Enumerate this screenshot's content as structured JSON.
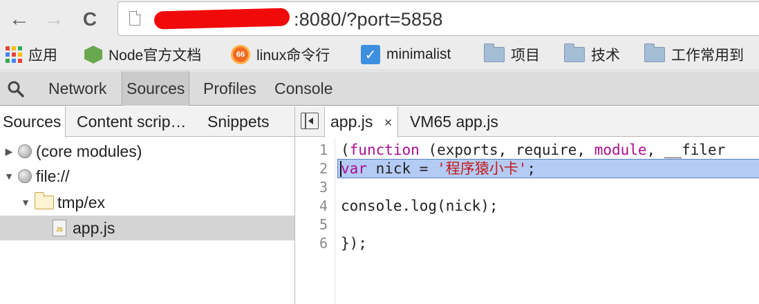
{
  "browser": {
    "back_icon": "←",
    "forward_icon": "→",
    "reload_icon": "C",
    "url_visible": ":8080/?port=5858"
  },
  "bookmarks": [
    {
      "label": "应用",
      "icon": "apps-grid-icon"
    },
    {
      "label": "Node官方文档",
      "icon": "node-icon"
    },
    {
      "label": "linux命令行",
      "icon": "site-66-icon"
    },
    {
      "label": "minimalist",
      "icon": "checkbox-icon"
    },
    {
      "label": "项目",
      "icon": "folder-icon"
    },
    {
      "label": "技术",
      "icon": "folder-icon"
    },
    {
      "label": "工作常用到",
      "icon": "folder-icon"
    }
  ],
  "devtools": {
    "tabs": [
      "Network",
      "Sources",
      "Profiles",
      "Console"
    ],
    "active_tab": "Sources"
  },
  "navigator": {
    "tabs": [
      "Sources",
      "Content scrip…",
      "Snippets"
    ],
    "tree": [
      {
        "label": "(core modules)",
        "arrow": "▶",
        "icon": "globe-icon"
      },
      {
        "label": "file://",
        "arrow": "▼",
        "icon": "globe-icon"
      },
      {
        "label": "tmp/ex",
        "arrow": "▼",
        "icon": "folder-icon"
      },
      {
        "label": "app.js",
        "arrow": "",
        "icon": "js-file-icon",
        "selected": true
      }
    ]
  },
  "editor": {
    "tabs": [
      {
        "label": "app.js",
        "closable": true,
        "active": true
      },
      {
        "label": "VM65 app.js",
        "closable": false,
        "active": false
      }
    ],
    "close_glyph": "×",
    "line_numbers": [
      "1",
      "2",
      "3",
      "4",
      "5",
      "6"
    ],
    "code": {
      "l1_open": "(",
      "l1_kw": "function",
      "l1_args": " (exports, require, ",
      "l1_kw2": "module",
      "l1_rest": ", __filer",
      "l2_kw": "var",
      "l2_mid": " nick = ",
      "l2_str": "'程序猿小卡'",
      "l2_end": ";",
      "l4": "console.log(nick);",
      "l6": "});"
    }
  },
  "colors": {
    "keyword": "#aa0d91",
    "string": "#c41a16",
    "highlight": "#b4cbf5",
    "redaction": "#f00a0a"
  }
}
